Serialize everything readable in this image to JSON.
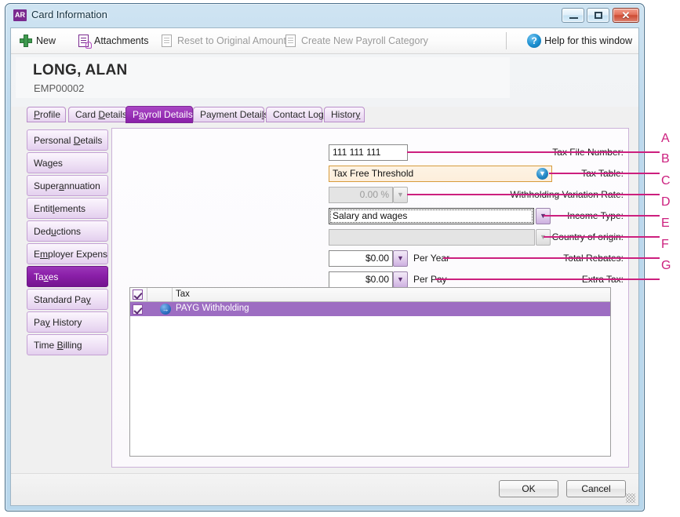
{
  "window": {
    "title": "Card Information",
    "app_icon_text": "AR",
    "buttons": {
      "minimize": "Minimize",
      "maximize": "Maximize",
      "close": "Close",
      "close_glyph": "✕"
    }
  },
  "toolbar": {
    "items": [
      {
        "label": "New",
        "icon": "plus-icon",
        "disabled": false
      },
      {
        "label": "Attachments",
        "icon": "attachment-document-icon",
        "disabled": false
      },
      {
        "label": "Reset to Original Amount",
        "icon": "reset-document-icon",
        "disabled": true
      },
      {
        "label": "Create New Payroll Category",
        "icon": "new-document-icon",
        "disabled": true
      }
    ],
    "help": {
      "label": "Help for this window",
      "icon": "help-icon",
      "glyph": "?"
    }
  },
  "header": {
    "employee_name": "LONG, ALAN",
    "employee_id": "EMP00002"
  },
  "tabs": [
    {
      "label": "Profile",
      "mnemonic": "P",
      "active": false
    },
    {
      "label": "Card Details",
      "mnemonic": "D",
      "active": false
    },
    {
      "label": "Payroll Details",
      "mnemonic": "a",
      "active": true
    },
    {
      "label": "Payment Details",
      "mnemonic": "l",
      "active": false
    },
    {
      "label": "Contact Log",
      "mnemonic": "g",
      "active": false
    },
    {
      "label": "History",
      "mnemonic": "y",
      "active": false
    }
  ],
  "sidebar": {
    "items": [
      {
        "label": "Personal Details",
        "mnemonic": "D",
        "active": false
      },
      {
        "label": "Wages",
        "mnemonic": "g",
        "active": false
      },
      {
        "label": "Superannuation",
        "mnemonic": "a",
        "active": false
      },
      {
        "label": "Entitlements",
        "mnemonic": "l",
        "active": false
      },
      {
        "label": "Deductions",
        "mnemonic": "u",
        "active": false
      },
      {
        "label": "Employer Expenses",
        "mnemonic": "m",
        "active": false
      },
      {
        "label": "Taxes",
        "mnemonic": "x",
        "active": true
      },
      {
        "label": "Standard Pay",
        "mnemonic": "y",
        "active": false
      },
      {
        "label": "Pay History",
        "mnemonic": "y",
        "active": false
      },
      {
        "label": "Time Billing",
        "mnemonic": "B",
        "active": false
      }
    ]
  },
  "form": {
    "tax_file_number": {
      "label": "Tax File Number:",
      "value": "111 111 111"
    },
    "tax_table": {
      "label": "Tax Table:",
      "value": "Tax Free Threshold",
      "dropdown_glyph": "▼"
    },
    "withholding_variation_rate": {
      "label": "Withholding Variation Rate:",
      "value": "0.00 %",
      "disabled": true,
      "spinner_glyph": "▼"
    },
    "income_type": {
      "label": "Income Type:",
      "value": "Salary and wages",
      "dropdown_glyph": "▼",
      "focused": true
    },
    "country_of_origin": {
      "label": "Country of origin:",
      "value": "",
      "disabled": true,
      "dropdown_glyph": "▼"
    },
    "total_rebates": {
      "label": "Total Rebates:",
      "value": "$0.00",
      "suffix": "Per Year",
      "spinner_glyph": "▼"
    },
    "extra_tax": {
      "label": "Extra Tax:",
      "value": "$0.00",
      "suffix": "Per Pay",
      "spinner_glyph": "▼"
    }
  },
  "grid": {
    "columns": [
      "",
      "",
      "Tax"
    ],
    "header_checkbox_checked": true,
    "rows": [
      {
        "checked": true,
        "arrow": "→",
        "tax": "PAYG Withholding",
        "selected": true
      }
    ]
  },
  "footer": {
    "ok": "OK",
    "cancel": "Cancel"
  },
  "annotations": {
    "color": "#cc1f7e",
    "letters": [
      {
        "letter": "A",
        "target": "tax_file_number"
      },
      {
        "letter": "B",
        "target": "tax_table"
      },
      {
        "letter": "C",
        "target": "withholding_variation_rate"
      },
      {
        "letter": "D",
        "target": "income_type"
      },
      {
        "letter": "E",
        "target": "country_of_origin"
      },
      {
        "letter": "F",
        "target": "total_rebates"
      },
      {
        "letter": "G",
        "target": "extra_tax"
      }
    ]
  },
  "colors": {
    "accent_purple": "#8a1fa8",
    "selection_purple": "#9d6dc2",
    "highlight_orange_border": "#d79b3c",
    "annotation_pink": "#cc1f7e"
  }
}
